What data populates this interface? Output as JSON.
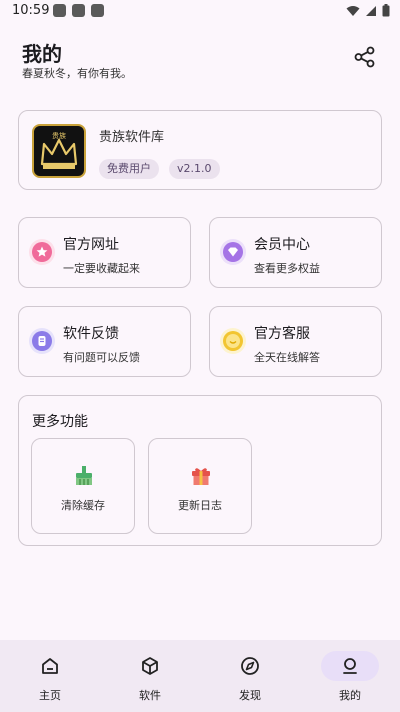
{
  "status_bar": {
    "time": "10:59"
  },
  "header": {
    "title": "我的",
    "subtitle": "春夏秋冬，有你有我。"
  },
  "app_card": {
    "name": "贵族软件库",
    "logo_text": "贵族",
    "user_type": "免费用户",
    "version": "v2.1.0"
  },
  "grid": [
    {
      "title": "官方网址",
      "subtitle": "一定要收藏起来",
      "icon": "star-icon",
      "color": "#f06b9a"
    },
    {
      "title": "会员中心",
      "subtitle": "查看更多权益",
      "icon": "diamond-icon",
      "color": "#a574e6"
    },
    {
      "title": "软件反馈",
      "subtitle": "有问题可以反馈",
      "icon": "feedback-icon",
      "color": "#8b7be8"
    },
    {
      "title": "官方客服",
      "subtitle": "全天在线解答",
      "icon": "smile-icon",
      "color": "#f2c531"
    }
  ],
  "more": {
    "title": "更多功能",
    "tools": [
      {
        "label": "清除缓存",
        "icon": "broom-icon"
      },
      {
        "label": "更新日志",
        "icon": "gift-icon"
      }
    ]
  },
  "nav": {
    "items": [
      {
        "label": "主页",
        "icon": "home-icon"
      },
      {
        "label": "软件",
        "icon": "cube-icon"
      },
      {
        "label": "发现",
        "icon": "compass-icon"
      },
      {
        "label": "我的",
        "icon": "profile-icon"
      }
    ],
    "active_index": 3
  },
  "colors": {
    "background": "#fcf6fc",
    "accent": "#e8def8",
    "chip": "#ebe2ee",
    "nav": "#f1e9f3"
  }
}
